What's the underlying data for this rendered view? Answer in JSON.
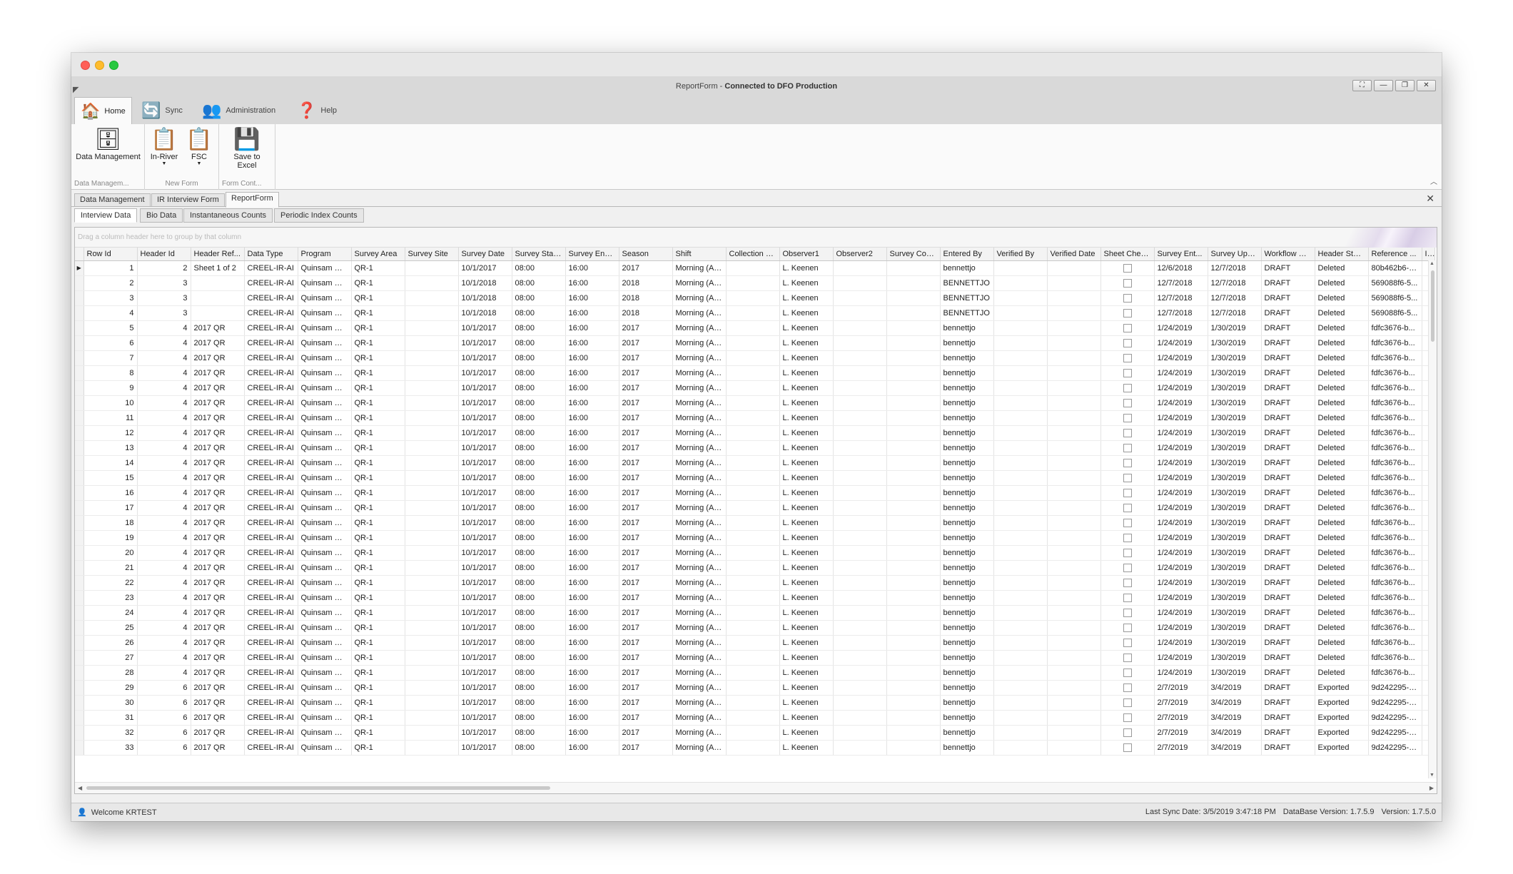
{
  "window": {
    "title_prefix": "ReportForm - ",
    "title_status": "Connected to DFO Production",
    "controls": [
      "⛶",
      "—",
      "❐",
      "✕"
    ]
  },
  "ribbon": {
    "tabs": [
      {
        "label": "Home",
        "icon": "🏠"
      },
      {
        "label": "Sync",
        "icon": "🔄"
      },
      {
        "label": "Administration",
        "icon": "👥"
      },
      {
        "label": "Help",
        "icon": "❓"
      }
    ],
    "groups": [
      {
        "label": "Data Managem...",
        "buttons": [
          {
            "label": "Data Management",
            "icon": "🗄"
          }
        ]
      },
      {
        "label": "New Form",
        "buttons": [
          {
            "label": "In-River",
            "icon": "📋"
          },
          {
            "label": "FSC",
            "icon": "📋"
          }
        ]
      },
      {
        "label": "Form Cont...",
        "buttons": [
          {
            "label": "Save to",
            "label2": "Excel",
            "icon": "💾"
          }
        ]
      }
    ]
  },
  "document_tabs": [
    "Data Management",
    "IR Interview Form",
    "ReportForm"
  ],
  "sub_tabs": [
    "Interview Data",
    "Bio Data",
    "Instantaneous Counts",
    "Periodic Index Counts"
  ],
  "grid": {
    "group_hint": "Drag a column header here to group by that column",
    "columns": [
      "Row Id",
      "Header Id",
      "Header Ref...",
      "Data Type",
      "Program",
      "Survey Area",
      "Survey Site",
      "Survey Date",
      "Survey Star...",
      "Survey End ...",
      "Season",
      "Shift",
      "Collection M...",
      "Observer1",
      "Observer2",
      "Survey Com...",
      "Entered By",
      "Verified By",
      "Verified Date",
      "Sheet Chec...",
      "Survey Ent...",
      "Survey Upd...",
      "Workflow St...",
      "Header Stat...",
      "Reference ...",
      "In"
    ],
    "rows": [
      [
        "1",
        "2",
        "Sheet 1 of 2",
        "CREEL-IR-AI",
        "Quinsam Ri...",
        "QR-1",
        "",
        "10/1/2017",
        "08:00",
        "16:00",
        "2017",
        "Morning (AM)",
        "",
        "L. Keenen",
        "",
        "",
        "bennettjo",
        "",
        "",
        "",
        "12/6/2018",
        "12/7/2018",
        "DRAFT",
        "Deleted",
        "80b462b6-4..."
      ],
      [
        "2",
        "3",
        "",
        "CREEL-IR-AI",
        "Quinsam Ri...",
        "QR-1",
        "",
        "10/1/2018",
        "08:00",
        "16:00",
        "2018",
        "Morning (AM)",
        "",
        "L. Keenen",
        "",
        "",
        "BENNETTJO",
        "",
        "",
        "",
        "12/7/2018",
        "12/7/2018",
        "DRAFT",
        "Deleted",
        "569088f6-5..."
      ],
      [
        "3",
        "3",
        "",
        "CREEL-IR-AI",
        "Quinsam Ri...",
        "QR-1",
        "",
        "10/1/2018",
        "08:00",
        "16:00",
        "2018",
        "Morning (AM)",
        "",
        "L. Keenen",
        "",
        "",
        "BENNETTJO",
        "",
        "",
        "",
        "12/7/2018",
        "12/7/2018",
        "DRAFT",
        "Deleted",
        "569088f6-5..."
      ],
      [
        "4",
        "3",
        "",
        "CREEL-IR-AI",
        "Quinsam Ri...",
        "QR-1",
        "",
        "10/1/2018",
        "08:00",
        "16:00",
        "2018",
        "Morning (AM)",
        "",
        "L. Keenen",
        "",
        "",
        "BENNETTJO",
        "",
        "",
        "",
        "12/7/2018",
        "12/7/2018",
        "DRAFT",
        "Deleted",
        "569088f6-5..."
      ],
      [
        "5",
        "4",
        "2017 QR",
        "CREEL-IR-AI",
        "Quinsam Ri...",
        "QR-1",
        "",
        "10/1/2017",
        "08:00",
        "16:00",
        "2017",
        "Morning (AM)",
        "",
        "L. Keenen",
        "",
        "",
        "bennettjo",
        "",
        "",
        "",
        "1/24/2019",
        "1/30/2019",
        "DRAFT",
        "Deleted",
        "fdfc3676-b..."
      ],
      [
        "6",
        "4",
        "2017 QR",
        "CREEL-IR-AI",
        "Quinsam Ri...",
        "QR-1",
        "",
        "10/1/2017",
        "08:00",
        "16:00",
        "2017",
        "Morning (AM)",
        "",
        "L. Keenen",
        "",
        "",
        "bennettjo",
        "",
        "",
        "",
        "1/24/2019",
        "1/30/2019",
        "DRAFT",
        "Deleted",
        "fdfc3676-b..."
      ],
      [
        "7",
        "4",
        "2017 QR",
        "CREEL-IR-AI",
        "Quinsam Ri...",
        "QR-1",
        "",
        "10/1/2017",
        "08:00",
        "16:00",
        "2017",
        "Morning (AM)",
        "",
        "L. Keenen",
        "",
        "",
        "bennettjo",
        "",
        "",
        "",
        "1/24/2019",
        "1/30/2019",
        "DRAFT",
        "Deleted",
        "fdfc3676-b..."
      ],
      [
        "8",
        "4",
        "2017 QR",
        "CREEL-IR-AI",
        "Quinsam Ri...",
        "QR-1",
        "",
        "10/1/2017",
        "08:00",
        "16:00",
        "2017",
        "Morning (AM)",
        "",
        "L. Keenen",
        "",
        "",
        "bennettjo",
        "",
        "",
        "",
        "1/24/2019",
        "1/30/2019",
        "DRAFT",
        "Deleted",
        "fdfc3676-b..."
      ],
      [
        "9",
        "4",
        "2017 QR",
        "CREEL-IR-AI",
        "Quinsam Ri...",
        "QR-1",
        "",
        "10/1/2017",
        "08:00",
        "16:00",
        "2017",
        "Morning (AM)",
        "",
        "L. Keenen",
        "",
        "",
        "bennettjo",
        "",
        "",
        "",
        "1/24/2019",
        "1/30/2019",
        "DRAFT",
        "Deleted",
        "fdfc3676-b..."
      ],
      [
        "10",
        "4",
        "2017 QR",
        "CREEL-IR-AI",
        "Quinsam Ri...",
        "QR-1",
        "",
        "10/1/2017",
        "08:00",
        "16:00",
        "2017",
        "Morning (AM)",
        "",
        "L. Keenen",
        "",
        "",
        "bennettjo",
        "",
        "",
        "",
        "1/24/2019",
        "1/30/2019",
        "DRAFT",
        "Deleted",
        "fdfc3676-b..."
      ],
      [
        "11",
        "4",
        "2017 QR",
        "CREEL-IR-AI",
        "Quinsam Ri...",
        "QR-1",
        "",
        "10/1/2017",
        "08:00",
        "16:00",
        "2017",
        "Morning (AM)",
        "",
        "L. Keenen",
        "",
        "",
        "bennettjo",
        "",
        "",
        "",
        "1/24/2019",
        "1/30/2019",
        "DRAFT",
        "Deleted",
        "fdfc3676-b..."
      ],
      [
        "12",
        "4",
        "2017 QR",
        "CREEL-IR-AI",
        "Quinsam Ri...",
        "QR-1",
        "",
        "10/1/2017",
        "08:00",
        "16:00",
        "2017",
        "Morning (AM)",
        "",
        "L. Keenen",
        "",
        "",
        "bennettjo",
        "",
        "",
        "",
        "1/24/2019",
        "1/30/2019",
        "DRAFT",
        "Deleted",
        "fdfc3676-b..."
      ],
      [
        "13",
        "4",
        "2017 QR",
        "CREEL-IR-AI",
        "Quinsam Ri...",
        "QR-1",
        "",
        "10/1/2017",
        "08:00",
        "16:00",
        "2017",
        "Morning (AM)",
        "",
        "L. Keenen",
        "",
        "",
        "bennettjo",
        "",
        "",
        "",
        "1/24/2019",
        "1/30/2019",
        "DRAFT",
        "Deleted",
        "fdfc3676-b..."
      ],
      [
        "14",
        "4",
        "2017 QR",
        "CREEL-IR-AI",
        "Quinsam Ri...",
        "QR-1",
        "",
        "10/1/2017",
        "08:00",
        "16:00",
        "2017",
        "Morning (AM)",
        "",
        "L. Keenen",
        "",
        "",
        "bennettjo",
        "",
        "",
        "",
        "1/24/2019",
        "1/30/2019",
        "DRAFT",
        "Deleted",
        "fdfc3676-b..."
      ],
      [
        "15",
        "4",
        "2017 QR",
        "CREEL-IR-AI",
        "Quinsam Ri...",
        "QR-1",
        "",
        "10/1/2017",
        "08:00",
        "16:00",
        "2017",
        "Morning (AM)",
        "",
        "L. Keenen",
        "",
        "",
        "bennettjo",
        "",
        "",
        "",
        "1/24/2019",
        "1/30/2019",
        "DRAFT",
        "Deleted",
        "fdfc3676-b..."
      ],
      [
        "16",
        "4",
        "2017 QR",
        "CREEL-IR-AI",
        "Quinsam Ri...",
        "QR-1",
        "",
        "10/1/2017",
        "08:00",
        "16:00",
        "2017",
        "Morning (AM)",
        "",
        "L. Keenen",
        "",
        "",
        "bennettjo",
        "",
        "",
        "",
        "1/24/2019",
        "1/30/2019",
        "DRAFT",
        "Deleted",
        "fdfc3676-b..."
      ],
      [
        "17",
        "4",
        "2017 QR",
        "CREEL-IR-AI",
        "Quinsam Ri...",
        "QR-1",
        "",
        "10/1/2017",
        "08:00",
        "16:00",
        "2017",
        "Morning (AM)",
        "",
        "L. Keenen",
        "",
        "",
        "bennettjo",
        "",
        "",
        "",
        "1/24/2019",
        "1/30/2019",
        "DRAFT",
        "Deleted",
        "fdfc3676-b..."
      ],
      [
        "18",
        "4",
        "2017 QR",
        "CREEL-IR-AI",
        "Quinsam Ri...",
        "QR-1",
        "",
        "10/1/2017",
        "08:00",
        "16:00",
        "2017",
        "Morning (AM)",
        "",
        "L. Keenen",
        "",
        "",
        "bennettjo",
        "",
        "",
        "",
        "1/24/2019",
        "1/30/2019",
        "DRAFT",
        "Deleted",
        "fdfc3676-b..."
      ],
      [
        "19",
        "4",
        "2017 QR",
        "CREEL-IR-AI",
        "Quinsam Ri...",
        "QR-1",
        "",
        "10/1/2017",
        "08:00",
        "16:00",
        "2017",
        "Morning (AM)",
        "",
        "L. Keenen",
        "",
        "",
        "bennettjo",
        "",
        "",
        "",
        "1/24/2019",
        "1/30/2019",
        "DRAFT",
        "Deleted",
        "fdfc3676-b..."
      ],
      [
        "20",
        "4",
        "2017 QR",
        "CREEL-IR-AI",
        "Quinsam Ri...",
        "QR-1",
        "",
        "10/1/2017",
        "08:00",
        "16:00",
        "2017",
        "Morning (AM)",
        "",
        "L. Keenen",
        "",
        "",
        "bennettjo",
        "",
        "",
        "",
        "1/24/2019",
        "1/30/2019",
        "DRAFT",
        "Deleted",
        "fdfc3676-b..."
      ],
      [
        "21",
        "4",
        "2017 QR",
        "CREEL-IR-AI",
        "Quinsam Ri...",
        "QR-1",
        "",
        "10/1/2017",
        "08:00",
        "16:00",
        "2017",
        "Morning (AM)",
        "",
        "L. Keenen",
        "",
        "",
        "bennettjo",
        "",
        "",
        "",
        "1/24/2019",
        "1/30/2019",
        "DRAFT",
        "Deleted",
        "fdfc3676-b..."
      ],
      [
        "22",
        "4",
        "2017 QR",
        "CREEL-IR-AI",
        "Quinsam Ri...",
        "QR-1",
        "",
        "10/1/2017",
        "08:00",
        "16:00",
        "2017",
        "Morning (AM)",
        "",
        "L. Keenen",
        "",
        "",
        "bennettjo",
        "",
        "",
        "",
        "1/24/2019",
        "1/30/2019",
        "DRAFT",
        "Deleted",
        "fdfc3676-b..."
      ],
      [
        "23",
        "4",
        "2017 QR",
        "CREEL-IR-AI",
        "Quinsam Ri...",
        "QR-1",
        "",
        "10/1/2017",
        "08:00",
        "16:00",
        "2017",
        "Morning (AM)",
        "",
        "L. Keenen",
        "",
        "",
        "bennettjo",
        "",
        "",
        "",
        "1/24/2019",
        "1/30/2019",
        "DRAFT",
        "Deleted",
        "fdfc3676-b..."
      ],
      [
        "24",
        "4",
        "2017 QR",
        "CREEL-IR-AI",
        "Quinsam Ri...",
        "QR-1",
        "",
        "10/1/2017",
        "08:00",
        "16:00",
        "2017",
        "Morning (AM)",
        "",
        "L. Keenen",
        "",
        "",
        "bennettjo",
        "",
        "",
        "",
        "1/24/2019",
        "1/30/2019",
        "DRAFT",
        "Deleted",
        "fdfc3676-b..."
      ],
      [
        "25",
        "4",
        "2017 QR",
        "CREEL-IR-AI",
        "Quinsam Ri...",
        "QR-1",
        "",
        "10/1/2017",
        "08:00",
        "16:00",
        "2017",
        "Morning (AM)",
        "",
        "L. Keenen",
        "",
        "",
        "bennettjo",
        "",
        "",
        "",
        "1/24/2019",
        "1/30/2019",
        "DRAFT",
        "Deleted",
        "fdfc3676-b..."
      ],
      [
        "26",
        "4",
        "2017 QR",
        "CREEL-IR-AI",
        "Quinsam Ri...",
        "QR-1",
        "",
        "10/1/2017",
        "08:00",
        "16:00",
        "2017",
        "Morning (AM)",
        "",
        "L. Keenen",
        "",
        "",
        "bennettjo",
        "",
        "",
        "",
        "1/24/2019",
        "1/30/2019",
        "DRAFT",
        "Deleted",
        "fdfc3676-b..."
      ],
      [
        "27",
        "4",
        "2017 QR",
        "CREEL-IR-AI",
        "Quinsam Ri...",
        "QR-1",
        "",
        "10/1/2017",
        "08:00",
        "16:00",
        "2017",
        "Morning (AM)",
        "",
        "L. Keenen",
        "",
        "",
        "bennettjo",
        "",
        "",
        "",
        "1/24/2019",
        "1/30/2019",
        "DRAFT",
        "Deleted",
        "fdfc3676-b..."
      ],
      [
        "28",
        "4",
        "2017 QR",
        "CREEL-IR-AI",
        "Quinsam Ri...",
        "QR-1",
        "",
        "10/1/2017",
        "08:00",
        "16:00",
        "2017",
        "Morning (AM)",
        "",
        "L. Keenen",
        "",
        "",
        "bennettjo",
        "",
        "",
        "",
        "1/24/2019",
        "1/30/2019",
        "DRAFT",
        "Deleted",
        "fdfc3676-b..."
      ],
      [
        "29",
        "6",
        "2017 QR",
        "CREEL-IR-AI",
        "Quinsam Ri...",
        "QR-1",
        "",
        "10/1/2017",
        "08:00",
        "16:00",
        "2017",
        "Morning (AM)",
        "",
        "L. Keenen",
        "",
        "",
        "bennettjo",
        "",
        "",
        "",
        "2/7/2019",
        "3/4/2019",
        "DRAFT",
        "Exported",
        "9d242295-d..."
      ],
      [
        "30",
        "6",
        "2017 QR",
        "CREEL-IR-AI",
        "Quinsam Ri...",
        "QR-1",
        "",
        "10/1/2017",
        "08:00",
        "16:00",
        "2017",
        "Morning (AM)",
        "",
        "L. Keenen",
        "",
        "",
        "bennettjo",
        "",
        "",
        "",
        "2/7/2019",
        "3/4/2019",
        "DRAFT",
        "Exported",
        "9d242295-d..."
      ],
      [
        "31",
        "6",
        "2017 QR",
        "CREEL-IR-AI",
        "Quinsam Ri...",
        "QR-1",
        "",
        "10/1/2017",
        "08:00",
        "16:00",
        "2017",
        "Morning (AM)",
        "",
        "L. Keenen",
        "",
        "",
        "bennettjo",
        "",
        "",
        "",
        "2/7/2019",
        "3/4/2019",
        "DRAFT",
        "Exported",
        "9d242295-d..."
      ],
      [
        "32",
        "6",
        "2017 QR",
        "CREEL-IR-AI",
        "Quinsam Ri...",
        "QR-1",
        "",
        "10/1/2017",
        "08:00",
        "16:00",
        "2017",
        "Morning (AM)",
        "",
        "L. Keenen",
        "",
        "",
        "bennettjo",
        "",
        "",
        "",
        "2/7/2019",
        "3/4/2019",
        "DRAFT",
        "Exported",
        "9d242295-d..."
      ],
      [
        "33",
        "6",
        "2017 QR",
        "CREEL-IR-AI",
        "Quinsam Ri...",
        "QR-1",
        "",
        "10/1/2017",
        "08:00",
        "16:00",
        "2017",
        "Morning (AM)",
        "",
        "L. Keenen",
        "",
        "",
        "bennettjo",
        "",
        "",
        "",
        "2/7/2019",
        "3/4/2019",
        "DRAFT",
        "Exported",
        "9d242295-d..."
      ]
    ]
  },
  "statusbar": {
    "welcome": "Welcome KRTEST",
    "last_sync": "Last Sync Date: 3/5/2019 3:47:18 PM",
    "db_version": "DataBase Version: 1.7.5.9",
    "version": "Version: 1.7.5.0"
  }
}
